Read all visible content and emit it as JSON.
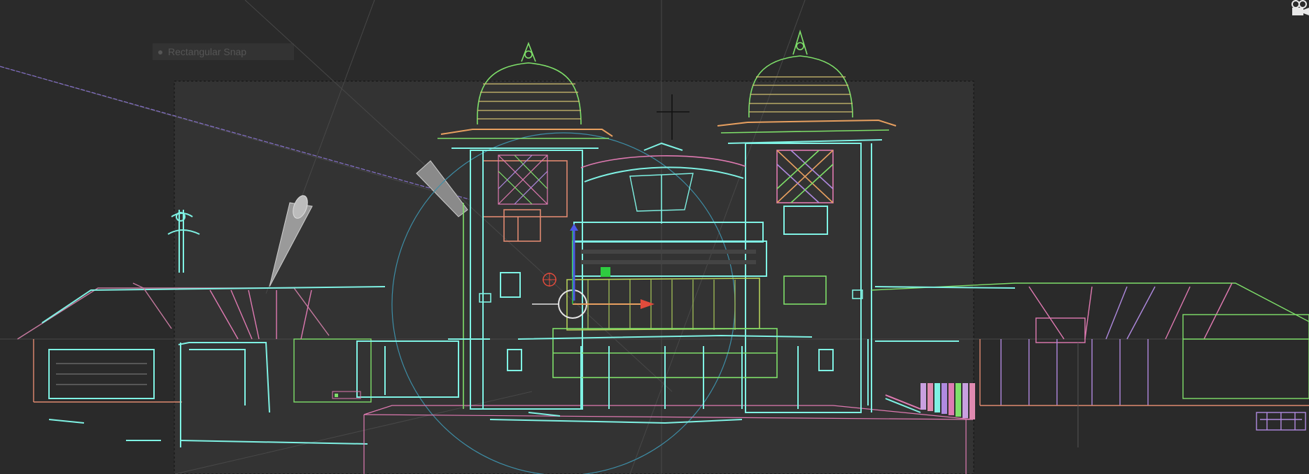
{
  "viewport": {
    "hint_label": "Rectangular Snap",
    "hint_icon": "snap-icon",
    "corner_icon": "camera-icon"
  },
  "colors": {
    "background": "#2a2a2a",
    "frame_fill": "#333333",
    "frame_border": "#111111",
    "cyan": "#7ff2e4",
    "green": "#7fe06a",
    "pink": "#e07ab2",
    "orange": "#e8a060",
    "purple": "#b08ae0",
    "gizmo_red": "#e24b3c",
    "gizmo_blue": "#4d59e8",
    "gizmo_green": "#2ecc40",
    "guide": "#4a4a4a",
    "light_cone": "#bdbdbd"
  }
}
